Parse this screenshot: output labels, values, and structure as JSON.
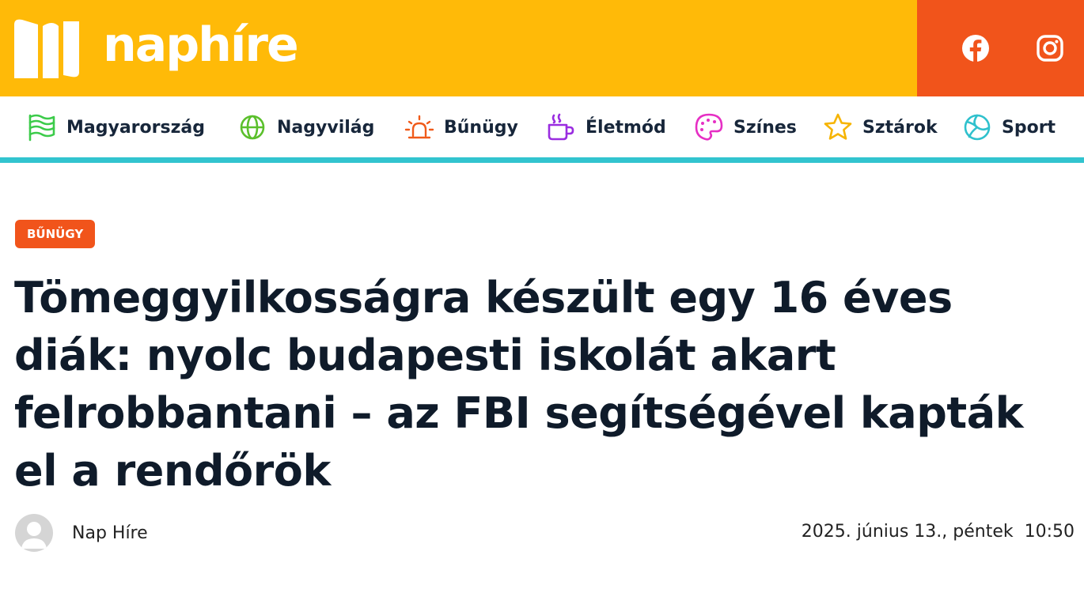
{
  "site": {
    "logo_text": "naphíre",
    "social": [
      {
        "icon": "facebook-icon"
      },
      {
        "icon": "instagram-icon"
      }
    ]
  },
  "nav": {
    "items": [
      {
        "label": "Magyarország",
        "icon": "flag-icon",
        "color": "#3ccb4a"
      },
      {
        "label": "Nagyvilág",
        "icon": "globe-icon",
        "color": "#5bc02c"
      },
      {
        "label": "Bűnügy",
        "icon": "siren-icon",
        "color": "#f05a1a"
      },
      {
        "label": "Életmód",
        "icon": "coffee-cup-icon",
        "color": "#9a2de0"
      },
      {
        "label": "Színes",
        "icon": "palette-icon",
        "color": "#e62fc4"
      },
      {
        "label": "Sztárok",
        "icon": "star-icon",
        "color": "#f6b400"
      },
      {
        "label": "Sport",
        "icon": "ball-icon",
        "color": "#2fc1cd"
      }
    ]
  },
  "article": {
    "category": "BŰNÜGY",
    "headline": "Tömeggyilkosságra készült egy 16 éves diák: nyolc budapesti iskolát akart felrobbantani – az FBI segítségével kapták el a rendőrök",
    "author": "Nap Híre",
    "date": "2025. június 13., péntek  10:50"
  },
  "colors": {
    "brand_yellow": "#ffba08",
    "brand_orange": "#f1541b",
    "accent_teal": "#32c4cf",
    "text_dark": "#0f1b2a"
  }
}
